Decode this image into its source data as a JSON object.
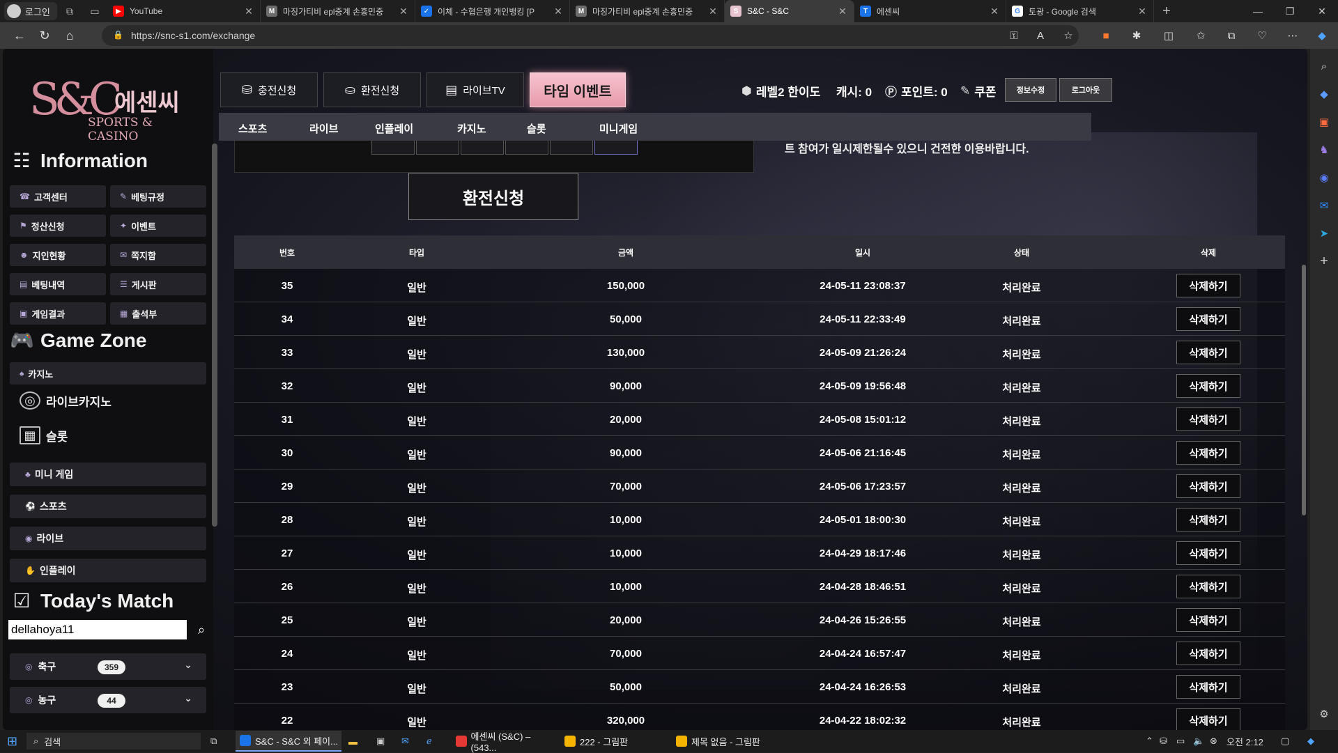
{
  "browser": {
    "profile_label": "로그인",
    "tabs": [
      {
        "title": "YouTube",
        "color": "#ff0000",
        "glyph": "▶"
      },
      {
        "title": "마징가티비 epl중계 손흥민중",
        "color": "#6d6d6d",
        "glyph": "M"
      },
      {
        "title": "이체 - 수협은행 개인뱅킹 [P",
        "color": "#1a73e8",
        "glyph": "✓"
      },
      {
        "title": "마징가티비 epl중계 손흥민중",
        "color": "#6d6d6d",
        "glyph": "M"
      },
      {
        "title": "S&C - S&C",
        "color": "#e8c4d0",
        "glyph": "S"
      },
      {
        "title": "에센씨",
        "color": "#1a73e8",
        "glyph": "T"
      },
      {
        "title": "토광 - Google 검색",
        "color": "#ffffff",
        "glyph": "G"
      }
    ],
    "new_tab_glyph": "+",
    "url": "https://snc-s1.com/exchange"
  },
  "logo": {
    "mark": "S&C",
    "korean": "에센씨",
    "english": "SPORTS & CASINO"
  },
  "sidebar": {
    "info_title": "Information",
    "info_buttons": [
      "고객센터",
      "베팅규정",
      "정산신청",
      "이벤트",
      "지인현황",
      "쪽지함",
      "베팅내역",
      "게시판",
      "게임결과",
      "출석부"
    ],
    "game_title": "Game Zone",
    "game_casino": "카지노",
    "game_live_casino": "라이브카지노",
    "game_slot": "슬롯",
    "game_buttons": [
      "미니 게임",
      "스포츠",
      "라이브",
      "인플레이"
    ],
    "match_title": "Today's Match",
    "search_value": "dellahoya11",
    "sports": [
      {
        "name": "축구",
        "count": "359"
      },
      {
        "name": "농구",
        "count": "44"
      }
    ]
  },
  "top": {
    "btn_deposit": "충전신청",
    "btn_exchange": "환전신청",
    "btn_livetv": "라이브TV",
    "btn_event": "타임 이벤트",
    "level": "레벨2 한이도",
    "cash": "캐시: 0",
    "points": "포인트: 0",
    "coupon": "쿠폰",
    "btn_edit": "정보수정",
    "btn_logout": "로그아웃"
  },
  "nav": [
    "스포츠",
    "라이브",
    "인플레이",
    "카지노",
    "슬롯",
    "미니게임"
  ],
  "notice": "트 참여가 일시제한될수 있으니 건전한 이용바랍니다.",
  "exchange_button": "환전신청",
  "table": {
    "headers": [
      "번호",
      "타입",
      "금액",
      "일시",
      "상태",
      "삭제"
    ],
    "delete_label": "삭제하기",
    "rows": [
      [
        "35",
        "일반",
        "150,000",
        "24-05-11 23:08:37",
        "처리완료"
      ],
      [
        "34",
        "일반",
        "50,000",
        "24-05-11 22:33:49",
        "처리완료"
      ],
      [
        "33",
        "일반",
        "130,000",
        "24-05-09 21:26:24",
        "처리완료"
      ],
      [
        "32",
        "일반",
        "90,000",
        "24-05-09 19:56:48",
        "처리완료"
      ],
      [
        "31",
        "일반",
        "20,000",
        "24-05-08 15:01:12",
        "처리완료"
      ],
      [
        "30",
        "일반",
        "90,000",
        "24-05-06 21:16:45",
        "처리완료"
      ],
      [
        "29",
        "일반",
        "70,000",
        "24-05-06 17:23:57",
        "처리완료"
      ],
      [
        "28",
        "일반",
        "10,000",
        "24-05-01 18:00:30",
        "처리완료"
      ],
      [
        "27",
        "일반",
        "10,000",
        "24-04-29 18:17:46",
        "처리완료"
      ],
      [
        "26",
        "일반",
        "10,000",
        "24-04-28 18:46:51",
        "처리완료"
      ],
      [
        "25",
        "일반",
        "20,000",
        "24-04-26 15:26:55",
        "처리완료"
      ],
      [
        "24",
        "일반",
        "70,000",
        "24-04-24 16:57:47",
        "처리완료"
      ],
      [
        "23",
        "일반",
        "50,000",
        "24-04-24 16:26:53",
        "처리완료"
      ],
      [
        "22",
        "일반",
        "320,000",
        "24-04-22 18:02:32",
        "처리완료"
      ]
    ]
  },
  "taskbar": {
    "search_label": "검색",
    "tasks": [
      {
        "label": "S&C - S&C 외 페이...",
        "color": "#1a73e8"
      },
      {
        "label": "에센씨 (S&C) – (543...",
        "color": "#e53935"
      },
      {
        "label": "222 - 그림판",
        "color": "#f4b400"
      },
      {
        "label": "제목 없음 - 그림판",
        "color": "#f4b400"
      }
    ],
    "time": "오전 2:12"
  },
  "colors": {
    "accent_pink": "#e69aa9",
    "panel": "#232329",
    "table_header": "#2e2e36"
  }
}
